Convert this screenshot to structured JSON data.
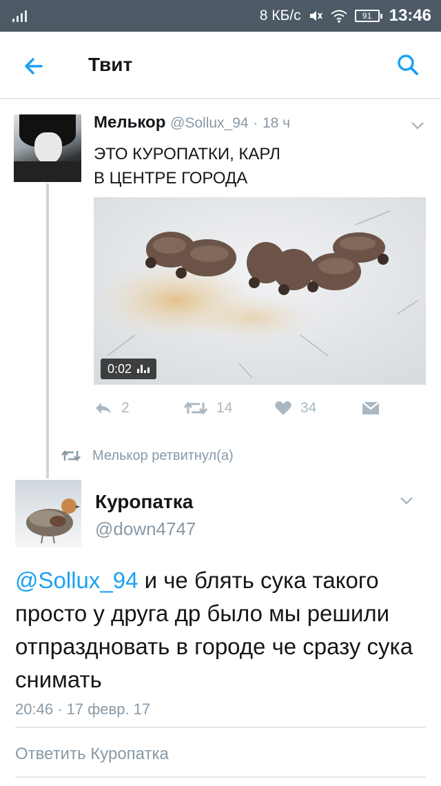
{
  "status_bar": {
    "network_speed": "8 КБ/с",
    "battery": "91",
    "time": "13:46"
  },
  "header": {
    "title": "Твит"
  },
  "tweet1": {
    "name": "Мелькор",
    "handle": "@Sollux_94",
    "time_ago": "18 ч",
    "text": "ЭТО КУРОПАТКИ, КАРЛ\nВ ЦЕНТРЕ ГОРОДА",
    "video_duration": "0:02",
    "replies": "2",
    "retweets": "14",
    "likes": "34"
  },
  "retweet_notice": "Мелькор ретвитнул(а)",
  "tweet2": {
    "name": "Куропатка",
    "handle": "@down4747",
    "mention": "@Sollux_94",
    "text": " и че блять сука такого просто у друга др было мы решили отпраздновать в городе че сразу сука снимать",
    "timestamp": "20:46 · 17 февр. 17"
  },
  "reply_placeholder": "Ответить Куропатка",
  "colors": {
    "accent": "#1da1f2",
    "muted": "#8899a6",
    "status_bar": "#4d5a66"
  },
  "icons": [
    "back-arrow-icon",
    "search-icon",
    "chevron-down-icon",
    "reply-icon",
    "retweet-icon",
    "heart-icon",
    "direct-message-icon",
    "signal-icon",
    "mute-icon",
    "wifi-icon",
    "battery-icon"
  ]
}
